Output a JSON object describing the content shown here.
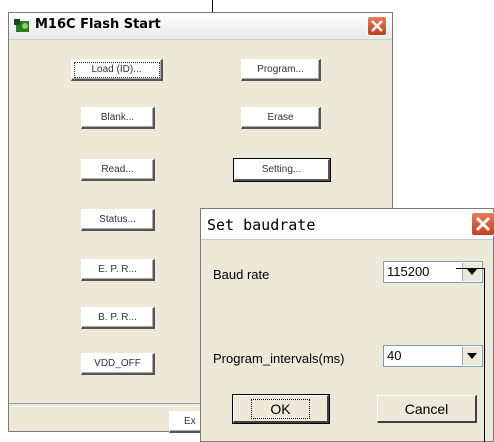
{
  "main_window": {
    "title": "M16C Flash Start",
    "buttons": {
      "load": "Load (ID)...",
      "program": "Program...",
      "blank": "Blank...",
      "erase": "Erase",
      "read": "Read...",
      "setting": "Setting...",
      "status": "Status...",
      "epr": "E. P. R...",
      "bpr": "B. P. R...",
      "vdd_off": "VDD_OFF",
      "exit": "Ex"
    }
  },
  "dialog": {
    "title": "Set baudrate",
    "baud_rate_label": "Baud rate",
    "baud_rate_value": "115200",
    "program_intervals_label": "Program_intervals(ms)",
    "program_intervals_value": "40",
    "ok_label": "OK",
    "cancel_label": "Cancel"
  },
  "colors": {
    "window_bg": "#ece9d8",
    "close_button": "#c4401f",
    "app_icon": "#2a7a2a"
  }
}
